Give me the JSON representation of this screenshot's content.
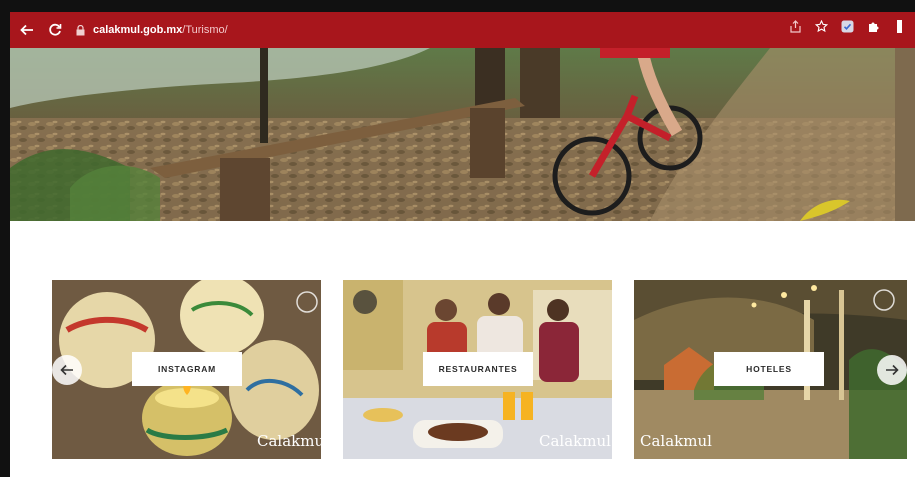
{
  "browser": {
    "url_host": "calakmul.gob.mx",
    "url_path": "/Turismo/",
    "icons": [
      "back-icon",
      "reload-icon",
      "lock-icon",
      "share-icon",
      "star-icon",
      "extension-check-icon",
      "puzzle-icon",
      "menu-icon"
    ]
  },
  "colors": {
    "toolbar": "#a8161c",
    "card_label_bg": "#ffffff"
  },
  "cards": [
    {
      "label": "INSTAGRAM",
      "brand": "Calakmu"
    },
    {
      "label": "RESTAURANTES",
      "brand": "Calakmul"
    },
    {
      "label": "HOTELES",
      "brand": "Calakmul"
    }
  ],
  "carousel": {
    "prev_icon": "arrow-left-icon",
    "next_icon": "arrow-right-icon"
  }
}
